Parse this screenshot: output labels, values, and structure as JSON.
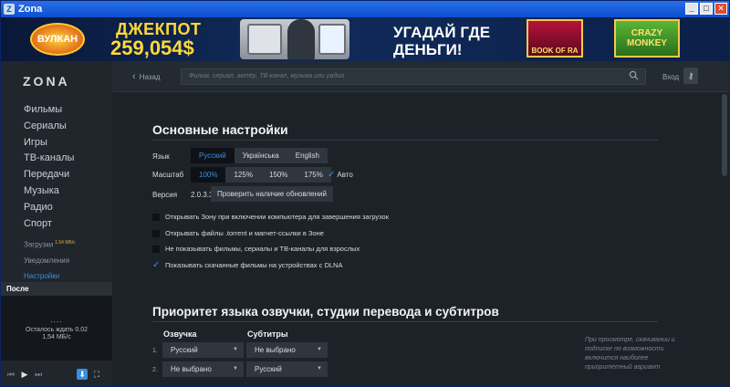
{
  "window": {
    "title": "Zona",
    "minimize": "_",
    "maximize": "□",
    "close": "✕"
  },
  "banner": {
    "vulkan_logo": "ВУЛКАН",
    "jackpot_label": "ДЖЕКПОТ",
    "jackpot_value": "259,054$",
    "slogan": "УГАДАЙ ГДЕ ДЕНЬГИ!",
    "slot1": "BOOK OF RA",
    "slot2": "CRAZY MONKEY"
  },
  "sidebar": {
    "logo": "ZONA",
    "items": [
      {
        "label": "Фильмы"
      },
      {
        "label": "Сериалы"
      },
      {
        "label": "Игры"
      },
      {
        "label": "ТВ-каналы"
      },
      {
        "label": "Передачи"
      },
      {
        "label": "Музыка"
      },
      {
        "label": "Радио"
      },
      {
        "label": "Спорт"
      }
    ],
    "downloads": "Загрузки",
    "downloads_speed": "1.54 МБ/с",
    "notifications": "Уведомления",
    "settings": "Настройки"
  },
  "after_panel": {
    "title": "После",
    "dots": "....",
    "wait": "Осталось ждать 0.02",
    "speed": "1,54 МБ/с"
  },
  "topbar": {
    "back": "Назад",
    "search_placeholder": "Фильм, сериал, актёр, ТВ-канал, музыка или радио",
    "login": "Вход"
  },
  "settings": {
    "title": "Основные настройки",
    "language_label": "Язык",
    "languages": [
      "Русский",
      "Українська",
      "English"
    ],
    "language_selected": "Русский",
    "scale_label": "Масштаб",
    "scales": [
      "100%",
      "125%",
      "150%",
      "175%"
    ],
    "scale_selected": "100%",
    "auto_label": "Авто",
    "version_label": "Версия",
    "version_value": "2.0.3.3",
    "update_button": "Проверить наличие обновлений",
    "checkboxes": [
      {
        "label": "Открывать Зону при включении компьютера для завершения загрузок",
        "checked": false
      },
      {
        "label": "Открывать файлы .torrent и магнет-ссылки в Зоне",
        "checked": false
      },
      {
        "label": "Не показывать фильмы, сериалы и ТВ-каналы для взрослых",
        "checked": false
      },
      {
        "label": "Показывать скачанные фильмы на устройствах с DLNA",
        "checked": true
      }
    ]
  },
  "priority": {
    "title": "Приоритет языка озвучки, студии перевода и субтитров",
    "voice_header": "Озвучка",
    "subs_header": "Субтитры",
    "rows": [
      {
        "num": "1.",
        "voice": "Русский",
        "subs": "Не выбрано"
      },
      {
        "num": "2.",
        "voice": "Не выбрано",
        "subs": "Русский"
      }
    ],
    "note": "При просмотре, скачивании и подписке по возможности включится наиболее приоритетный вариант"
  }
}
